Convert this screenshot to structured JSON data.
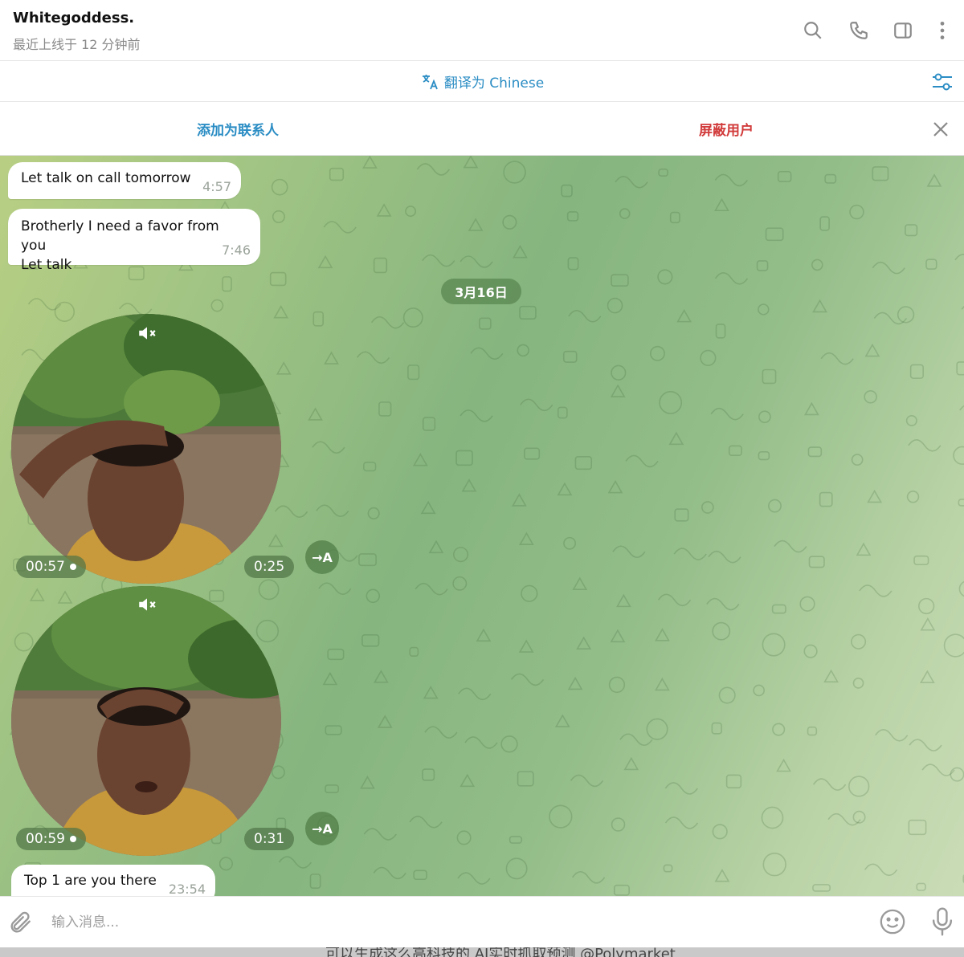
{
  "header": {
    "contact_name": "Whitegoddess.",
    "last_seen": "最近上线于 12 分钟前",
    "icons": [
      "search-icon",
      "phone-icon",
      "sidebar-toggle-icon",
      "more-vertical-icon"
    ]
  },
  "translate_bar": {
    "label": "翻译为 Chinese",
    "icon": "translate-icon",
    "settings_icon": "translate-settings-icon"
  },
  "action_bar": {
    "add_contact": "添加为联系人",
    "block_user": "屏蔽用户",
    "close_icon": "close-icon"
  },
  "messages": [
    {
      "text": "Let talk on call tomorrow",
      "time": "4:57"
    },
    {
      "line1": "Brotherly I need a favor from you",
      "line2": "Let talk",
      "time": "7:46"
    }
  ],
  "date_separator": "3月16日",
  "video_messages": [
    {
      "elapsed": "00:57",
      "duration": "0:25",
      "transcribe_label": "→A",
      "muted": true
    },
    {
      "elapsed": "00:59",
      "duration": "0:31",
      "transcribe_label": "→A",
      "muted": true
    }
  ],
  "last_message": {
    "text": "Top 1 are you there",
    "time": "23:54"
  },
  "input": {
    "placeholder": "输入消息...",
    "value": "",
    "icons": [
      "attach-icon",
      "emoji-icon",
      "microphone-icon"
    ]
  },
  "footer_caption": "可以生成这么高科技的 AI实时抓取预测 @Polymarket",
  "colors": {
    "accent_blue": "#2b8dc4",
    "danger_red": "#d23b3b",
    "chat_bg_green": "#93bd89"
  }
}
